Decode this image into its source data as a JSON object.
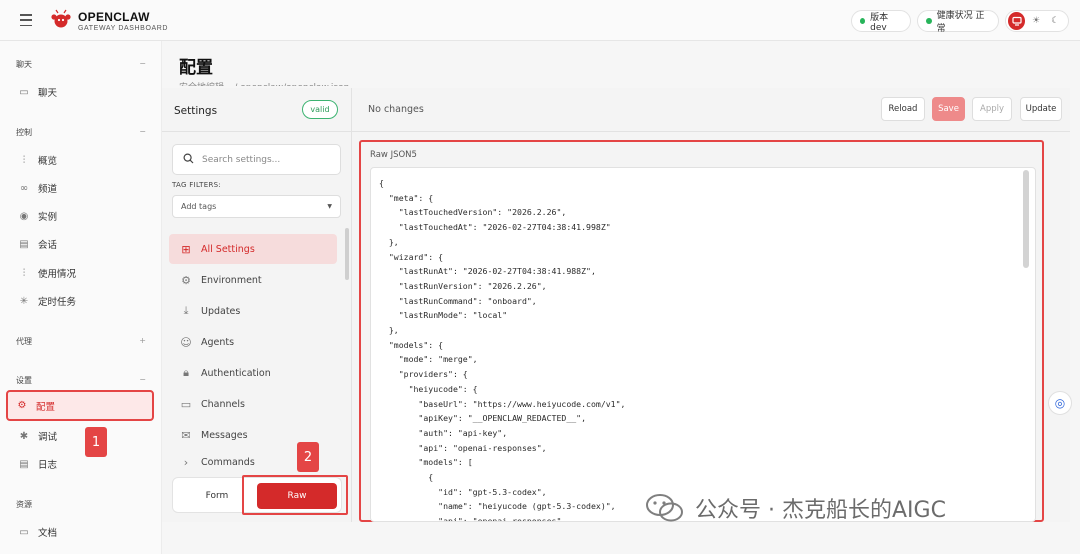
{
  "header": {
    "brand_name": "OPENCLAW",
    "brand_sub": "GATEWAY DASHBOARD",
    "version_label": "版本 dev",
    "health_label": "健康状况 正常"
  },
  "sidebar": {
    "sections": [
      {
        "title": "聊天",
        "toggle": "−"
      },
      {
        "title": "控制",
        "toggle": "−"
      },
      {
        "title": "代理",
        "toggle": "+"
      },
      {
        "title": "设置",
        "toggle": "−"
      },
      {
        "title": "资源",
        "toggle": ""
      }
    ],
    "items": [
      {
        "label": "聊天"
      },
      {
        "label": "概览"
      },
      {
        "label": "频道"
      },
      {
        "label": "实例"
      },
      {
        "label": "会话"
      },
      {
        "label": "使用情况"
      },
      {
        "label": "定时任务"
      },
      {
        "label": "配置"
      },
      {
        "label": "调试"
      },
      {
        "label": "日志"
      },
      {
        "label": "文档"
      }
    ]
  },
  "page": {
    "title": "配置",
    "subtitle": "安全地编辑 ~/.openclaw/openclaw.json"
  },
  "settings": {
    "title": "Settings",
    "status_badge": "valid",
    "search_placeholder": "Search settings...",
    "tag_filters_label": "TAG FILTERS:",
    "tag_select_value": "Add tags",
    "sections": [
      "All Settings",
      "Environment",
      "Updates",
      "Agents",
      "Authentication",
      "Channels",
      "Messages",
      "Commands"
    ],
    "mode_form": "Form",
    "mode_raw": "Raw"
  },
  "editor": {
    "status": "No changes",
    "reload": "Reload",
    "save": "Save",
    "apply": "Apply",
    "update": "Update",
    "raw_label": "Raw JSON5",
    "code": "{\n  \"meta\": {\n    \"lastTouchedVersion\": \"2026.2.26\",\n    \"lastTouchedAt\": \"2026-02-27T04:38:41.998Z\"\n  },\n  \"wizard\": {\n    \"lastRunAt\": \"2026-02-27T04:38:41.988Z\",\n    \"lastRunVersion\": \"2026.2.26\",\n    \"lastRunCommand\": \"onboard\",\n    \"lastRunMode\": \"local\"\n  },\n  \"models\": {\n    \"mode\": \"merge\",\n    \"providers\": {\n      \"heiyucode\": {\n        \"baseUrl\": \"https://www.heiyucode.com/v1\",\n        \"apiKey\": \"__OPENCLAW_REDACTED__\",\n        \"auth\": \"api-key\",\n        \"api\": \"openai-responses\",\n        \"models\": [\n          {\n            \"id\": \"gpt-5.3-codex\",\n            \"name\": \"heiyucode (gpt-5.3-codex)\",\n            \"api\": \"openai-responses\","
  },
  "annotations": {
    "marker_1": "1",
    "marker_2": "2"
  },
  "watermark": "公众号 · 杰克船长的AIGC",
  "colors": {
    "accent": "#d42a2a",
    "annotation": "#e44545",
    "ok": "#27b45a"
  }
}
